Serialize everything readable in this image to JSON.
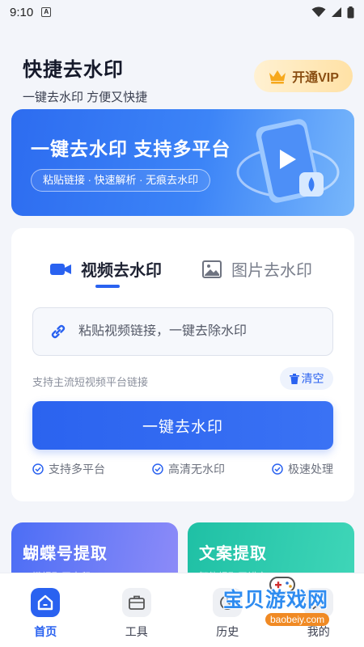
{
  "status_bar": {
    "time": "9:10",
    "app_indicator": "A"
  },
  "header": {
    "title": "快捷去水印",
    "subtitle": "一键去水印  方便又快捷",
    "vip_label": "开通VIP"
  },
  "banner": {
    "title": "一键去水印 支持多平台",
    "tags": "粘贴链接 · 快速解析 · 无痕去水印"
  },
  "tabs": [
    {
      "label": "视频去水印",
      "icon": "video-icon",
      "active": true
    },
    {
      "label": "图片去水印",
      "icon": "image-icon",
      "active": false
    }
  ],
  "input": {
    "placeholder": "粘贴视频链接，一键去除水印",
    "value": ""
  },
  "support_hint": "支持主流短视频平台链接",
  "clear_label": "清空",
  "main_action_label": "一键去水印",
  "features": [
    "支持多平台",
    "高清无水印",
    "极速处理"
  ],
  "cards": [
    {
      "title": "蝴蝶号提取",
      "subtitle": "一键提取无水印"
    },
    {
      "title": "文案提取",
      "subtitle": "智能提取无错字"
    }
  ],
  "nav": [
    {
      "label": "首页",
      "icon": "home-icon",
      "active": true
    },
    {
      "label": "工具",
      "icon": "toolbox-icon",
      "active": false
    },
    {
      "label": "历史",
      "icon": "history-icon",
      "active": false
    },
    {
      "label": "我的",
      "icon": "profile-icon",
      "active": false
    }
  ],
  "watermark": {
    "text": "宝贝游戏网",
    "url": "baobeiy.com"
  },
  "colors": {
    "accent": "#2a62f0",
    "vip_text": "#8a4e12",
    "card_left": "#4c6ef5",
    "card_right": "#1fc0a5"
  }
}
